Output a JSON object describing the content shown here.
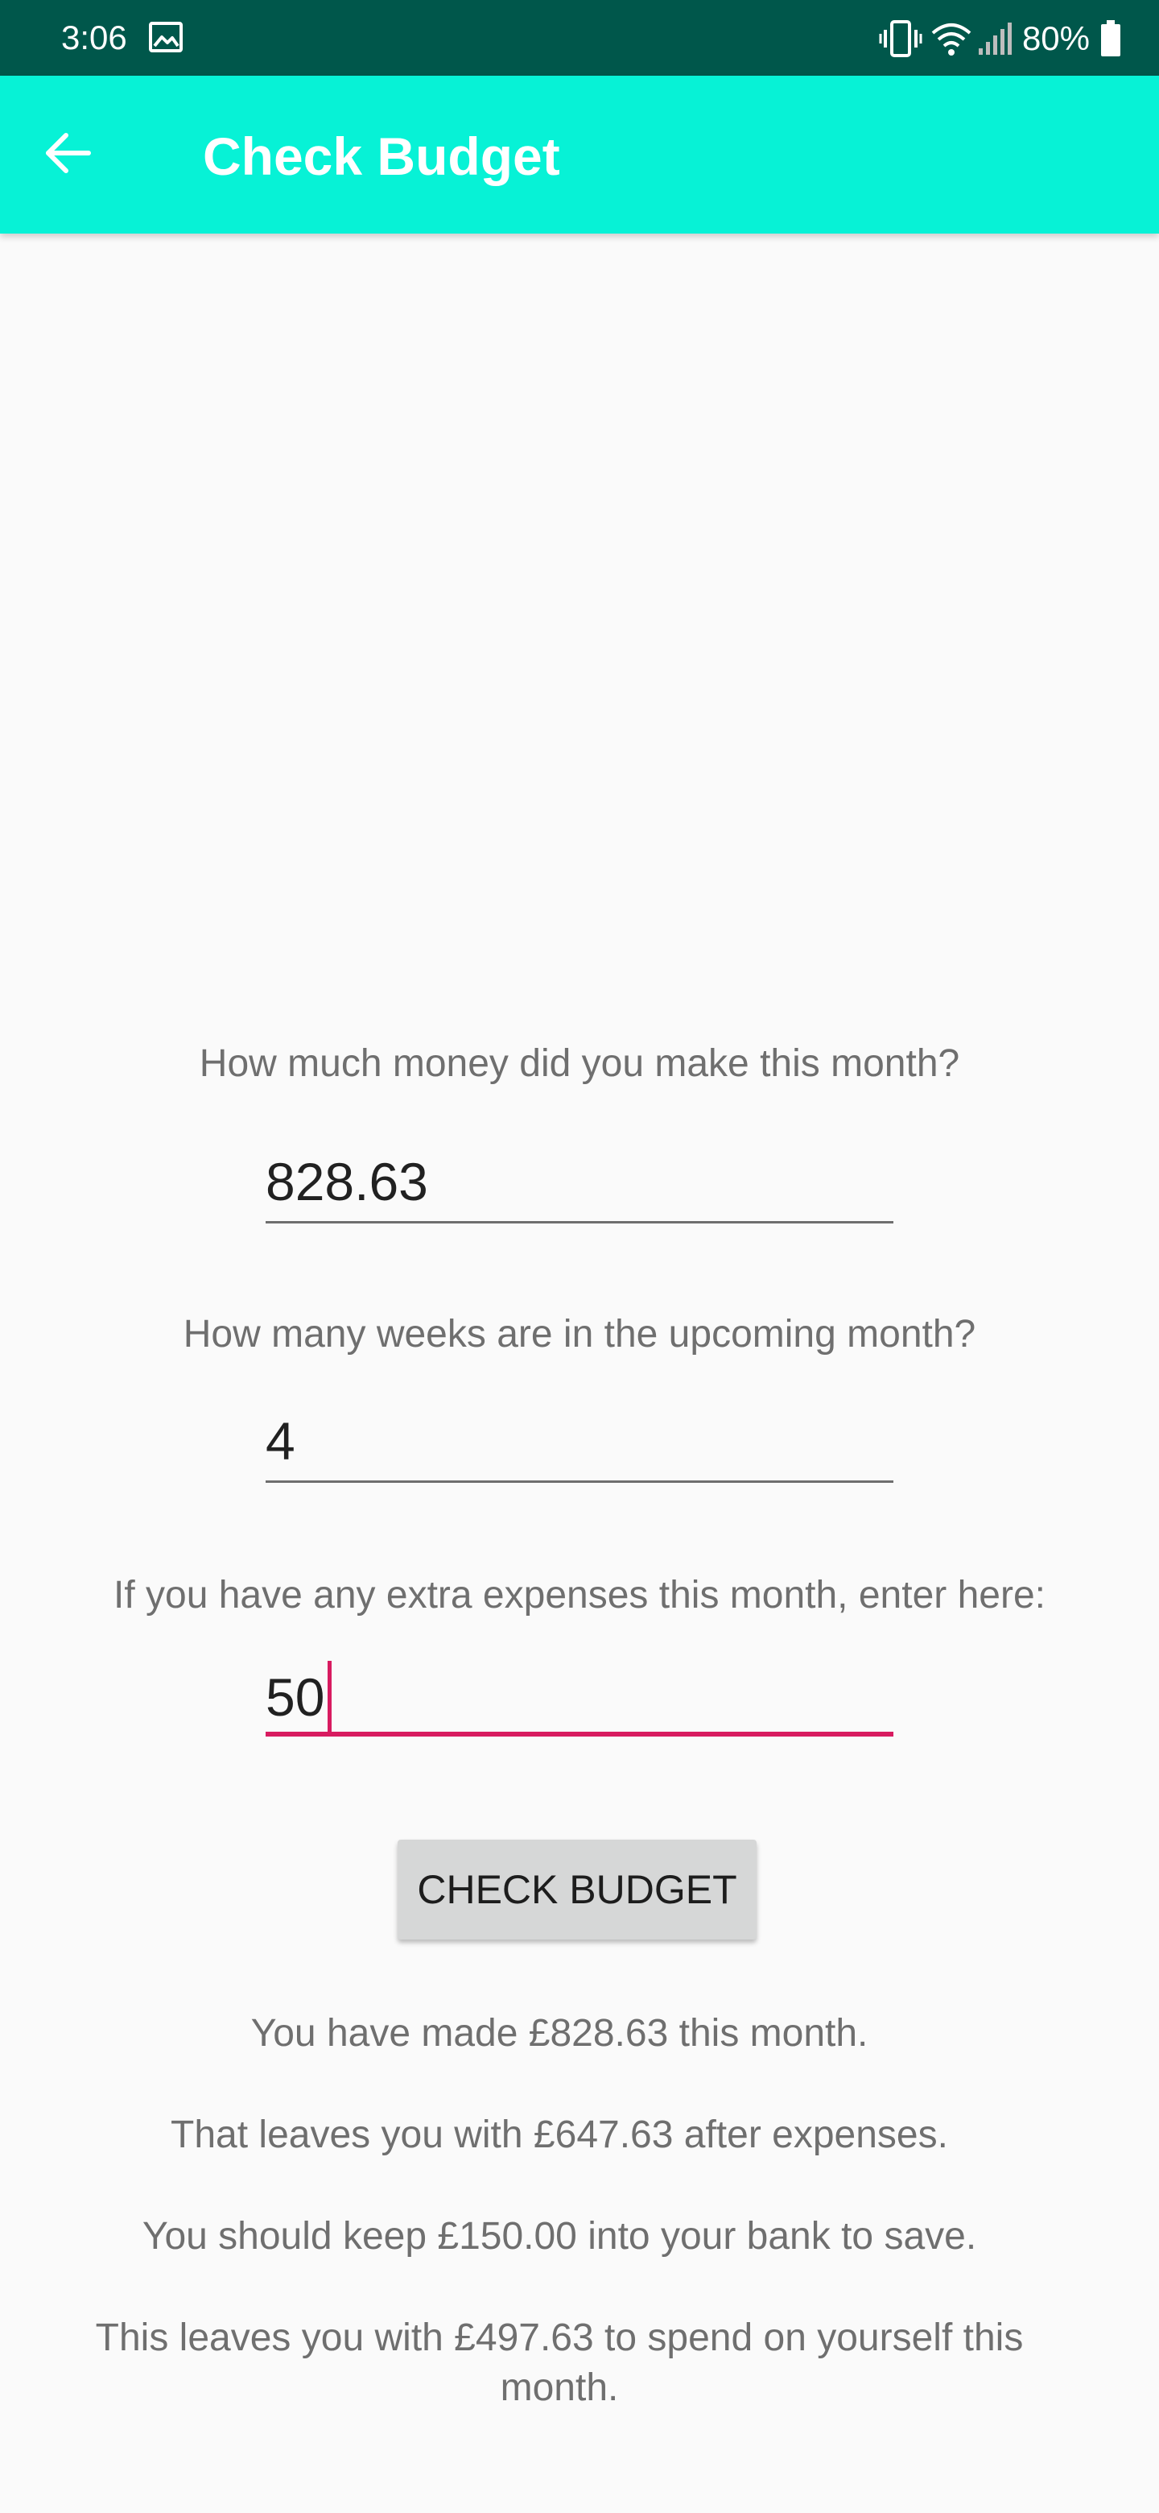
{
  "status_bar": {
    "time": "3:06",
    "battery": "80%",
    "icons": [
      "gallery-icon",
      "vibrate-icon",
      "wifi-icon",
      "signal-icon",
      "battery-icon"
    ]
  },
  "app_bar": {
    "title": "Check Budget",
    "back_icon": "arrow-back-icon",
    "color": "#07f2d6"
  },
  "form": {
    "income_question": "How much money did you make this month?",
    "income_value": "828.63",
    "weeks_question": "How many weeks are in the upcoming month?",
    "weeks_value": "4",
    "expenses_question": "If you have any extra expenses this month, enter here:",
    "expenses_value": "50",
    "button_label": "CHECK BUDGET"
  },
  "results": {
    "made": "You have made £828.63 this month.",
    "after_expenses": "That leaves you with £647.63 after expenses.",
    "save": "You should keep £150.00 into your bank to save.",
    "spend": "This leaves you with £497.63 to spend on yourself this month."
  },
  "colors": {
    "status_bar": "#00574b",
    "accent": "#d81b60",
    "button": "#d6d7d7"
  }
}
